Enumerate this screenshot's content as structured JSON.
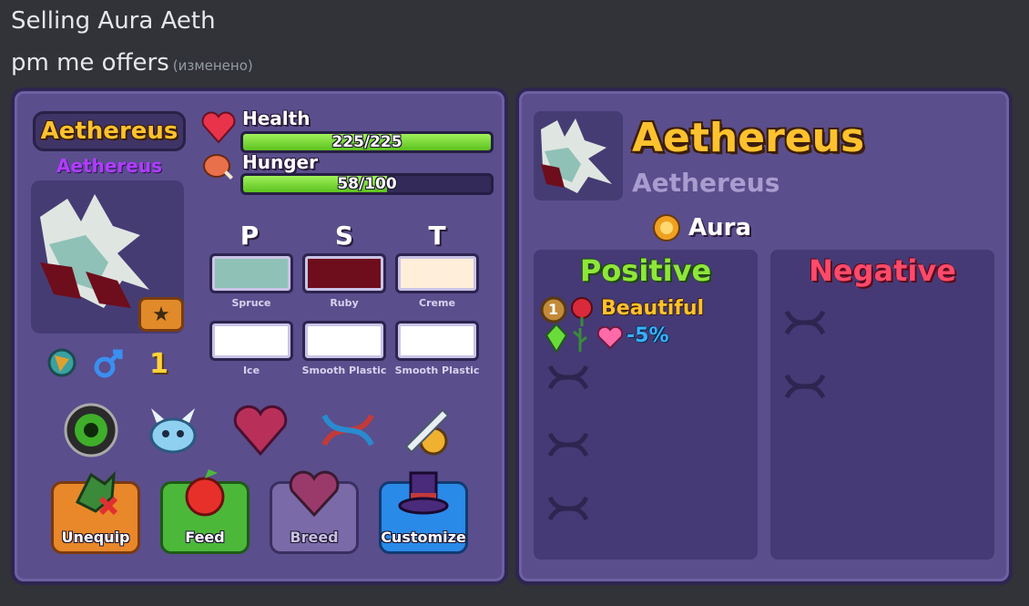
{
  "message": {
    "line1": "Selling Aura Aeth",
    "line2": "pm me offers",
    "edited": "(изменено)"
  },
  "pet_card": {
    "name": "Aethereus",
    "species": "Aethereus",
    "health_label": "Health",
    "health_value": "225/225",
    "health_fraction": 1.0,
    "hunger_label": "Hunger",
    "hunger_value": "58/100",
    "hunger_fraction": 0.58,
    "columns": [
      "P",
      "S",
      "T"
    ],
    "swatches": [
      {
        "label": "Spruce",
        "color": "#8fc1b6"
      },
      {
        "label": "Ruby",
        "color": "#6e0d1c"
      },
      {
        "label": "Creme",
        "color": "#ffeed9"
      },
      {
        "label": "Ice",
        "color": "#ffffff"
      },
      {
        "label": "Smooth Plastic",
        "color": "#ffffff"
      },
      {
        "label": "Smooth Plastic",
        "color": "#ffffff"
      }
    ],
    "age": "1",
    "buttons": {
      "unequip": "Unequip",
      "feed": "Feed",
      "breed": "Breed",
      "customize": "Customize"
    }
  },
  "detail_card": {
    "name": "Aethereus",
    "species": "Aethereus",
    "aura": "Aura",
    "positive_title": "Positive",
    "negative_title": "Negative",
    "trait_level": "1",
    "trait_name": "Beautiful",
    "trait_effect": "-5%"
  },
  "colors": {
    "gold": "#ffc22e",
    "positive": "#8fe63a",
    "negative": "#ff4a6a",
    "bar_fill": "#7fdc3a"
  }
}
